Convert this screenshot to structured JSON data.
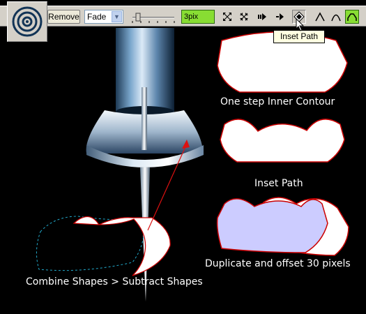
{
  "toolbar": {
    "remove_label": "Remove",
    "blend_select": {
      "value": "Fade"
    },
    "width_value": "3pix"
  },
  "tooltip": {
    "text": "Inset Path"
  },
  "captions": {
    "one_step": "One step Inner Contour",
    "inset_path": "Inset Path",
    "duplicate": "Duplicate and offset 30 pixels",
    "combine": "Combine Shapes > Subtract Shapes"
  },
  "colors": {
    "toolbar_bg": "#d4d0c8",
    "accent_green": "#88dd33",
    "shape_outline": "#cc0000",
    "duplicate_fill": "#ccccff",
    "dashed_outline": "#22aacc"
  }
}
